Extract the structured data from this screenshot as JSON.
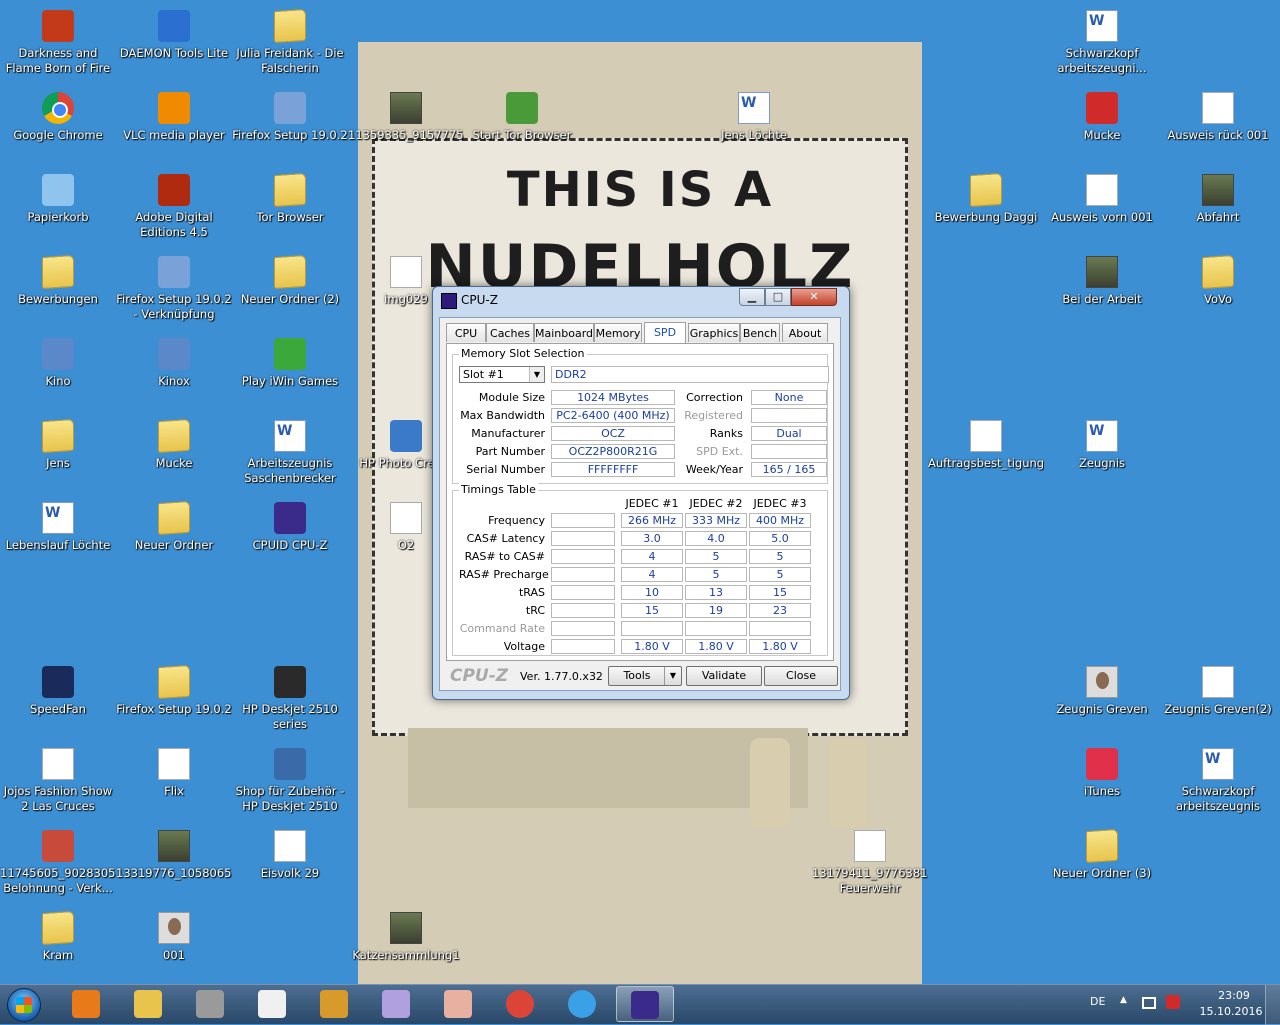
{
  "desktop": {
    "icons": [
      {
        "label": "Darkness and Flame Born of Fire",
        "icon": "game-icon",
        "kind": "app",
        "color": "#c23a1a"
      },
      {
        "label": "DAEMON Tools Lite",
        "icon": "daemon-tools-icon",
        "kind": "app",
        "color": "#2b6fd1"
      },
      {
        "label": "Julia Freidank - Die Falscherin",
        "icon": "folder-icon",
        "kind": "folder"
      },
      {
        "label": "Google Chrome",
        "icon": "chrome-icon",
        "kind": "chrome"
      },
      {
        "label": "VLC media player",
        "icon": "vlc-icon",
        "kind": "app",
        "color": "#f08a00"
      },
      {
        "label": "Firefox Setup 19.0.2",
        "icon": "installer-icon",
        "kind": "app",
        "color": "#7aa2d8"
      },
      {
        "label": "11359335_9157775....",
        "icon": "video-icon",
        "kind": "photo"
      },
      {
        "label": "Start Tor Browser",
        "icon": "tor-icon",
        "kind": "app",
        "color": "#4a9a3a"
      },
      {
        "label": "Jens Löchte",
        "icon": "word-doc-icon",
        "kind": "word"
      },
      {
        "label": "Schwarzkopf arbeitszeugni...",
        "icon": "word-doc-icon",
        "kind": "word"
      },
      {
        "label": "Mucke",
        "icon": "music-shortcut-icon",
        "kind": "app",
        "color": "#d02a2a"
      },
      {
        "label": "Ausweis rück 001",
        "icon": "image-icon",
        "kind": "doc"
      },
      {
        "label": "Papierkorb",
        "icon": "recycle-bin-icon",
        "kind": "app",
        "color": "#8ec4ee"
      },
      {
        "label": "Adobe Digital Editions 4.5",
        "icon": "adobe-icon",
        "kind": "app",
        "color": "#b02a10"
      },
      {
        "label": "Tor Browser",
        "icon": "folder-icon",
        "kind": "folder"
      },
      {
        "label": "Bewerbung Daggi",
        "icon": "folder-icon",
        "kind": "folder"
      },
      {
        "label": "Ausweis vorn 001",
        "icon": "image-icon",
        "kind": "doc"
      },
      {
        "label": "Abfahrt",
        "icon": "photo-icon",
        "kind": "photo"
      },
      {
        "label": "Bewerbungen",
        "icon": "folder-icon",
        "kind": "folder"
      },
      {
        "label": "Firefox Setup 19.0.2 - Verknüpfung",
        "icon": "installer-icon",
        "kind": "app",
        "color": "#7aa2d8"
      },
      {
        "label": "Neuer Ordner (2)",
        "icon": "folder-icon",
        "kind": "folder"
      },
      {
        "label": "img029",
        "icon": "document-icon",
        "kind": "doc"
      },
      {
        "label": "Bei der Arbeit",
        "icon": "photo-icon",
        "kind": "photo"
      },
      {
        "label": "VoVo",
        "icon": "folder-icon",
        "kind": "folder"
      },
      {
        "label": "Kino",
        "icon": "film-icon",
        "kind": "app",
        "color": "#5a88c8"
      },
      {
        "label": "Kinox",
        "icon": "film-icon",
        "kind": "app",
        "color": "#5a88c8"
      },
      {
        "label": "Play iWin Games",
        "icon": "iwin-icon",
        "kind": "app",
        "color": "#3aa83a"
      },
      {
        "label": "HP Photo Crea...",
        "icon": "hp-photo-icon",
        "kind": "app",
        "color": "#3a7ac8"
      },
      {
        "label": "Auftragsbest_tigung",
        "icon": "document-icon",
        "kind": "doc"
      },
      {
        "label": "Zeugnis",
        "icon": "word-doc-icon",
        "kind": "word"
      },
      {
        "label": "Jens",
        "icon": "folder-icon",
        "kind": "folder"
      },
      {
        "label": "Mucke",
        "icon": "folder-icon",
        "kind": "folder"
      },
      {
        "label": "Arbeitszeugnis Saschenbrecker",
        "icon": "word-doc-icon",
        "kind": "word"
      },
      {
        "label": "Lebenslauf Löchte",
        "icon": "word-doc-icon",
        "kind": "word"
      },
      {
        "label": "Neuer Ordner",
        "icon": "folder-icon",
        "kind": "folder"
      },
      {
        "label": "CPUID CPU-Z",
        "icon": "cpuz-icon",
        "kind": "app",
        "color": "#3a2a8a"
      },
      {
        "label": "O2",
        "icon": "document-icon",
        "kind": "doc"
      },
      {
        "label": "SpeedFan",
        "icon": "speedfan-icon",
        "kind": "app",
        "color": "#1a2a5a"
      },
      {
        "label": "Firefox Setup 19.0.2",
        "icon": "folder-icon",
        "kind": "folder"
      },
      {
        "label": "HP Deskjet 2510 series",
        "icon": "printer-icon",
        "kind": "app",
        "color": "#2a2a2a"
      },
      {
        "label": "Zeugnis Greven",
        "icon": "photo-icon",
        "kind": "face"
      },
      {
        "label": "Zeugnis Greven(2)",
        "icon": "document-icon",
        "kind": "doc"
      },
      {
        "label": "Jojos Fashion Show 2 Las Cruces",
        "icon": "game-icon",
        "kind": "doc"
      },
      {
        "label": "Flix",
        "icon": "document-icon",
        "kind": "doc"
      },
      {
        "label": "Shop für Zubehör - HP Deskjet 2510 s...",
        "icon": "printer-icon",
        "kind": "app",
        "color": "#3a6aa8"
      },
      {
        "label": "iTunes",
        "icon": "itunes-icon",
        "kind": "app",
        "color": "#e0304a"
      },
      {
        "label": "Schwarzkopf arbeitszeugnis",
        "icon": "word-doc-icon",
        "kind": "word"
      },
      {
        "label": "11745605_9028305.... Belohnung - Verk...",
        "icon": "image-icon",
        "kind": "app",
        "color": "#c84a3a"
      },
      {
        "label": "13319776_1058065....",
        "icon": "photo-icon",
        "kind": "photo"
      },
      {
        "label": "Eisvolk 29",
        "icon": "document-icon",
        "kind": "doc"
      },
      {
        "label": "13179411_9776381.... Feuerwehr",
        "icon": "image-icon",
        "kind": "doc"
      },
      {
        "label": "Neuer Ordner (3)",
        "icon": "folder-icon",
        "kind": "folder"
      },
      {
        "label": "Kram",
        "icon": "folder-icon",
        "kind": "folder"
      },
      {
        "label": "001",
        "icon": "photo-icon",
        "kind": "face"
      },
      {
        "label": "Katzensammlung1",
        "icon": "photo-icon",
        "kind": "photo"
      }
    ]
  },
  "wallpaper": {
    "line1": "THIS IS A",
    "line2": "NUDELHOLZ"
  },
  "cpuz": {
    "title": "CPU-Z",
    "title_buttons": {
      "minimize": "▁",
      "maximize": "□",
      "close": "✕"
    },
    "tabs": [
      "CPU",
      "Caches",
      "Mainboard",
      "Memory",
      "SPD",
      "Graphics",
      "Bench",
      "About"
    ],
    "active_tab": "SPD",
    "slot_group": "Memory Slot Selection",
    "slot": "Slot #1",
    "memory_type": "DDR2",
    "labels": {
      "module_size": "Module Size",
      "max_bandwidth": "Max Bandwidth",
      "manufacturer": "Manufacturer",
      "part_number": "Part Number",
      "serial_number": "Serial Number",
      "correction": "Correction",
      "registered": "Registered",
      "ranks": "Ranks",
      "spd_ext": "SPD Ext.",
      "week_year": "Week/Year"
    },
    "values": {
      "module_size": "1024 MBytes",
      "max_bandwidth": "PC2-6400 (400 MHz)",
      "manufacturer": "OCZ",
      "part_number": "OCZ2P800R21G",
      "serial_number": "FFFFFFFF",
      "correction": "None",
      "registered": "",
      "ranks": "Dual",
      "spd_ext": "",
      "week_year": "165 / 165"
    },
    "timings": {
      "title": "Timings Table",
      "columns": [
        "JEDEC #1",
        "JEDEC #2",
        "JEDEC #3"
      ],
      "rows": [
        {
          "label": "Frequency",
          "values": [
            "266 MHz",
            "333 MHz",
            "400 MHz"
          ],
          "dim": false
        },
        {
          "label": "CAS# Latency",
          "values": [
            "3.0",
            "4.0",
            "5.0"
          ],
          "dim": false
        },
        {
          "label": "RAS# to CAS#",
          "values": [
            "4",
            "5",
            "5"
          ],
          "dim": false
        },
        {
          "label": "RAS# Precharge",
          "values": [
            "4",
            "5",
            "5"
          ],
          "dim": false
        },
        {
          "label": "tRAS",
          "values": [
            "10",
            "13",
            "15"
          ],
          "dim": false
        },
        {
          "label": "tRC",
          "values": [
            "15",
            "19",
            "23"
          ],
          "dim": false
        },
        {
          "label": "Command Rate",
          "values": [
            "",
            "",
            ""
          ],
          "dim": true
        },
        {
          "label": "Voltage",
          "values": [
            "1.80 V",
            "1.80 V",
            "1.80 V"
          ],
          "dim": false
        }
      ]
    },
    "logo": "CPU-Z",
    "version": "Ver. 1.77.0.x32",
    "buttons": {
      "tools": "Tools",
      "validate": "Validate",
      "close": "Close"
    }
  },
  "taskbar": {
    "items": [
      {
        "name": "media-player",
        "icon": "media-player-icon",
        "color": "#e87a1a"
      },
      {
        "name": "explorer",
        "icon": "explorer-folder-icon",
        "color": "#e8c44c"
      },
      {
        "name": "tool",
        "icon": "gear-icon",
        "color": "#9a9a9a"
      },
      {
        "name": "solitaire",
        "icon": "cards-icon",
        "color": "#f0f0f0"
      },
      {
        "name": "game-king",
        "icon": "king-card-icon",
        "color": "#d89a2a"
      },
      {
        "name": "game-spider",
        "icon": "spider-solitaire-icon",
        "color": "#b0a0e0"
      },
      {
        "name": "game-cards",
        "icon": "freecell-icon",
        "color": "#e8b0a0"
      },
      {
        "name": "chrome",
        "icon": "chrome-icon",
        "color": "#db4437"
      },
      {
        "name": "ie",
        "icon": "internet-explorer-icon",
        "color": "#3aa0e8"
      },
      {
        "name": "cpuz",
        "icon": "cpuz-icon",
        "color": "#3a2a8a"
      }
    ],
    "tray": {
      "language": "DE",
      "time": "23:09",
      "date": "15.10.2016"
    }
  }
}
